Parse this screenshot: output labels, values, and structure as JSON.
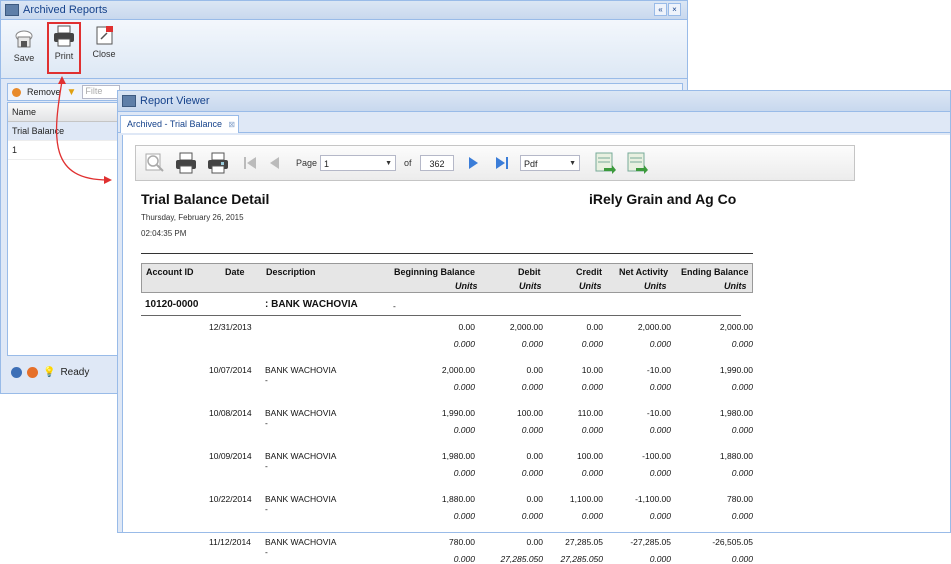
{
  "archived_window": {
    "title": "Archived Reports",
    "toolbar": {
      "save": "Save",
      "print": "Print",
      "close": "Close"
    },
    "filter": {
      "remove": "Remove",
      "placeholder": "Filte"
    },
    "grid": {
      "header": "Name",
      "rows": [
        "Trial Balance",
        "1"
      ]
    },
    "status": "Ready"
  },
  "viewer": {
    "title": "Report Viewer",
    "tab": "Archived - Trial Balance",
    "toolbar": {
      "page_label": "Page",
      "page_value": "1",
      "of_label": "of",
      "total_pages": "362",
      "format": "Pdf"
    }
  },
  "report": {
    "title": "Trial Balance Detail",
    "company": "iRely Grain and Ag Co",
    "date": "Thursday, February 26, 2015",
    "time": "02:04:35 PM",
    "columns": {
      "account": "Account ID",
      "date": "Date",
      "description": "Description",
      "beginning": "Beginning Balance",
      "debit": "Debit",
      "credit": "Credit",
      "net": "Net Activity",
      "ending": "Ending Balance",
      "units": "Units"
    },
    "account": {
      "id": "10120-0000",
      "name": ": BANK WACHOVIA",
      "suffix": "-"
    },
    "rows": [
      {
        "date": "12/31/2013",
        "desc": "",
        "begin": "0.00",
        "debit": "2,000.00",
        "credit": "0.00",
        "net": "2,000.00",
        "end": "2,000.00",
        "u": [
          "0.000",
          "0.000",
          "0.000",
          "0.000",
          "0.000"
        ]
      },
      {
        "date": "10/07/2014",
        "desc": "BANK WACHOVIA",
        "begin": "2,000.00",
        "debit": "0.00",
        "credit": "10.00",
        "net": "-10.00",
        "end": "1,990.00",
        "u": [
          "0.000",
          "0.000",
          "0.000",
          "0.000",
          "0.000"
        ]
      },
      {
        "date": "10/08/2014",
        "desc": "BANK WACHOVIA",
        "begin": "1,990.00",
        "debit": "100.00",
        "credit": "110.00",
        "net": "-10.00",
        "end": "1,980.00",
        "u": [
          "0.000",
          "0.000",
          "0.000",
          "0.000",
          "0.000"
        ]
      },
      {
        "date": "10/09/2014",
        "desc": "BANK WACHOVIA",
        "begin": "1,980.00",
        "debit": "0.00",
        "credit": "100.00",
        "net": "-100.00",
        "end": "1,880.00",
        "u": [
          "0.000",
          "0.000",
          "0.000",
          "0.000",
          "0.000"
        ]
      },
      {
        "date": "10/22/2014",
        "desc": "BANK WACHOVIA",
        "begin": "1,880.00",
        "debit": "0.00",
        "credit": "1,100.00",
        "net": "-1,100.00",
        "end": "780.00",
        "u": [
          "0.000",
          "0.000",
          "0.000",
          "0.000",
          "0.000"
        ]
      },
      {
        "date": "11/12/2014",
        "desc": "BANK WACHOVIA",
        "begin": "780.00",
        "debit": "0.00",
        "credit": "27,285.05",
        "net": "-27,285.05",
        "end": "-26,505.05",
        "u": [
          "0.000",
          "27,285.050",
          "27,285.050",
          "0.000",
          "0.000"
        ]
      }
    ],
    "dash": "-"
  },
  "colors": {
    "highlight": "#e03030",
    "accent": "#15428b"
  }
}
